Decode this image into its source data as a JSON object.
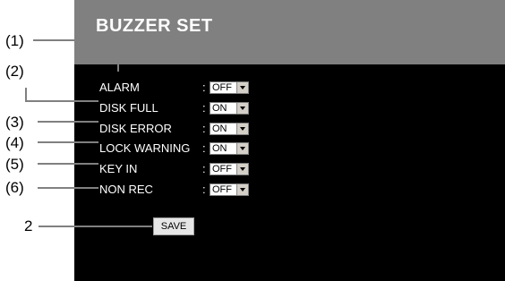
{
  "panel": {
    "title": "BUZZER SET",
    "rows": [
      {
        "label": "ALARM",
        "value": "OFF"
      },
      {
        "label": "DISK FULL",
        "value": "ON"
      },
      {
        "label": "DISK ERROR",
        "value": "ON"
      },
      {
        "label": "LOCK WARNING",
        "value": "ON"
      },
      {
        "label": "KEY IN",
        "value": "OFF"
      },
      {
        "label": "NON REC",
        "value": "OFF"
      }
    ],
    "separator": ":",
    "save_label": "SAVE"
  },
  "callouts": [
    "(1)",
    "(2)",
    "(3)",
    "(4)",
    "(5)",
    "(6)",
    "2"
  ],
  "colors": {
    "panel_background": "#000000",
    "header_background": "#808080",
    "text": "#ffffff"
  }
}
